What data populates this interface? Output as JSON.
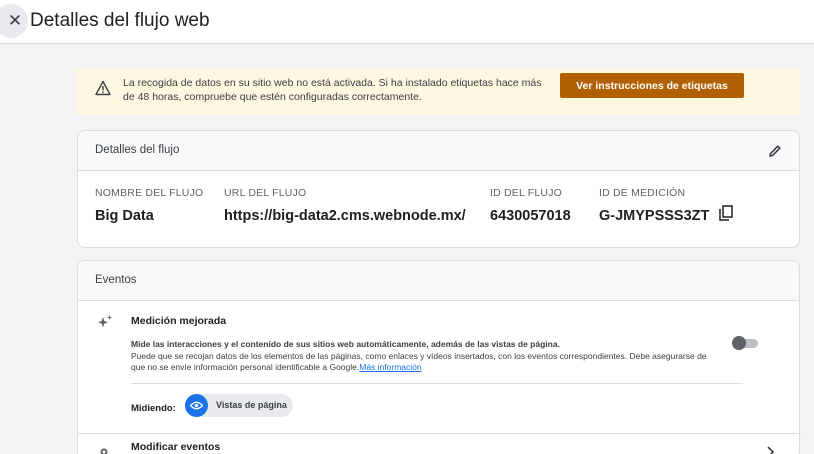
{
  "header": {
    "close_icon": "close-icon",
    "title": "Detalles del flujo web"
  },
  "banner": {
    "icon": "warning-icon",
    "text": "La recogida de datos en su sitio web no está activada. Si ha instalado etiquetas hace más de 48 horas, compruebe que estén configuradas correctamente.",
    "button_label": "Ver instrucciones de etiquetas",
    "colors": {
      "background": "#fef7e0",
      "button": "#b06000"
    }
  },
  "flow_details": {
    "title": "Detalles del flujo",
    "edit_icon": "pencil-icon",
    "fields": [
      {
        "label": "NOMBRE DEL FLUJO",
        "value": "Big Data"
      },
      {
        "label": "URL DEL FLUJO",
        "value": "https://big-data2.cms.webnode.mx/"
      },
      {
        "label": "ID DEL FLUJO",
        "value": "6430057018"
      },
      {
        "label": "ID DE MEDICIÓN",
        "value": "G-JMYPSSS3ZT"
      }
    ],
    "copy_icon": "copy-icon"
  },
  "events": {
    "title": "Eventos",
    "enhanced": {
      "icon": "sparkle-icon",
      "title": "Medición mejorada",
      "desc_strong": "Mide las interacciones y el contenido de sus sitios web automáticamente, además de las vistas de página.",
      "desc": "Puede que se recojan datos de los elementos de las páginas, como enlaces y vídeos insertados, con los eventos correspondientes. Debe asegurarse de que no se envíe información personal identificable a Google.",
      "link": "Más información",
      "toggle_on": false,
      "measuring_label": "Midiendo:",
      "chip_label": "Vistas de página",
      "chip_icon": "eye-icon"
    },
    "modify": {
      "icon": "touch-icon",
      "title": "Modificar eventos",
      "chevron_icon": "chevron-right-icon"
    }
  }
}
